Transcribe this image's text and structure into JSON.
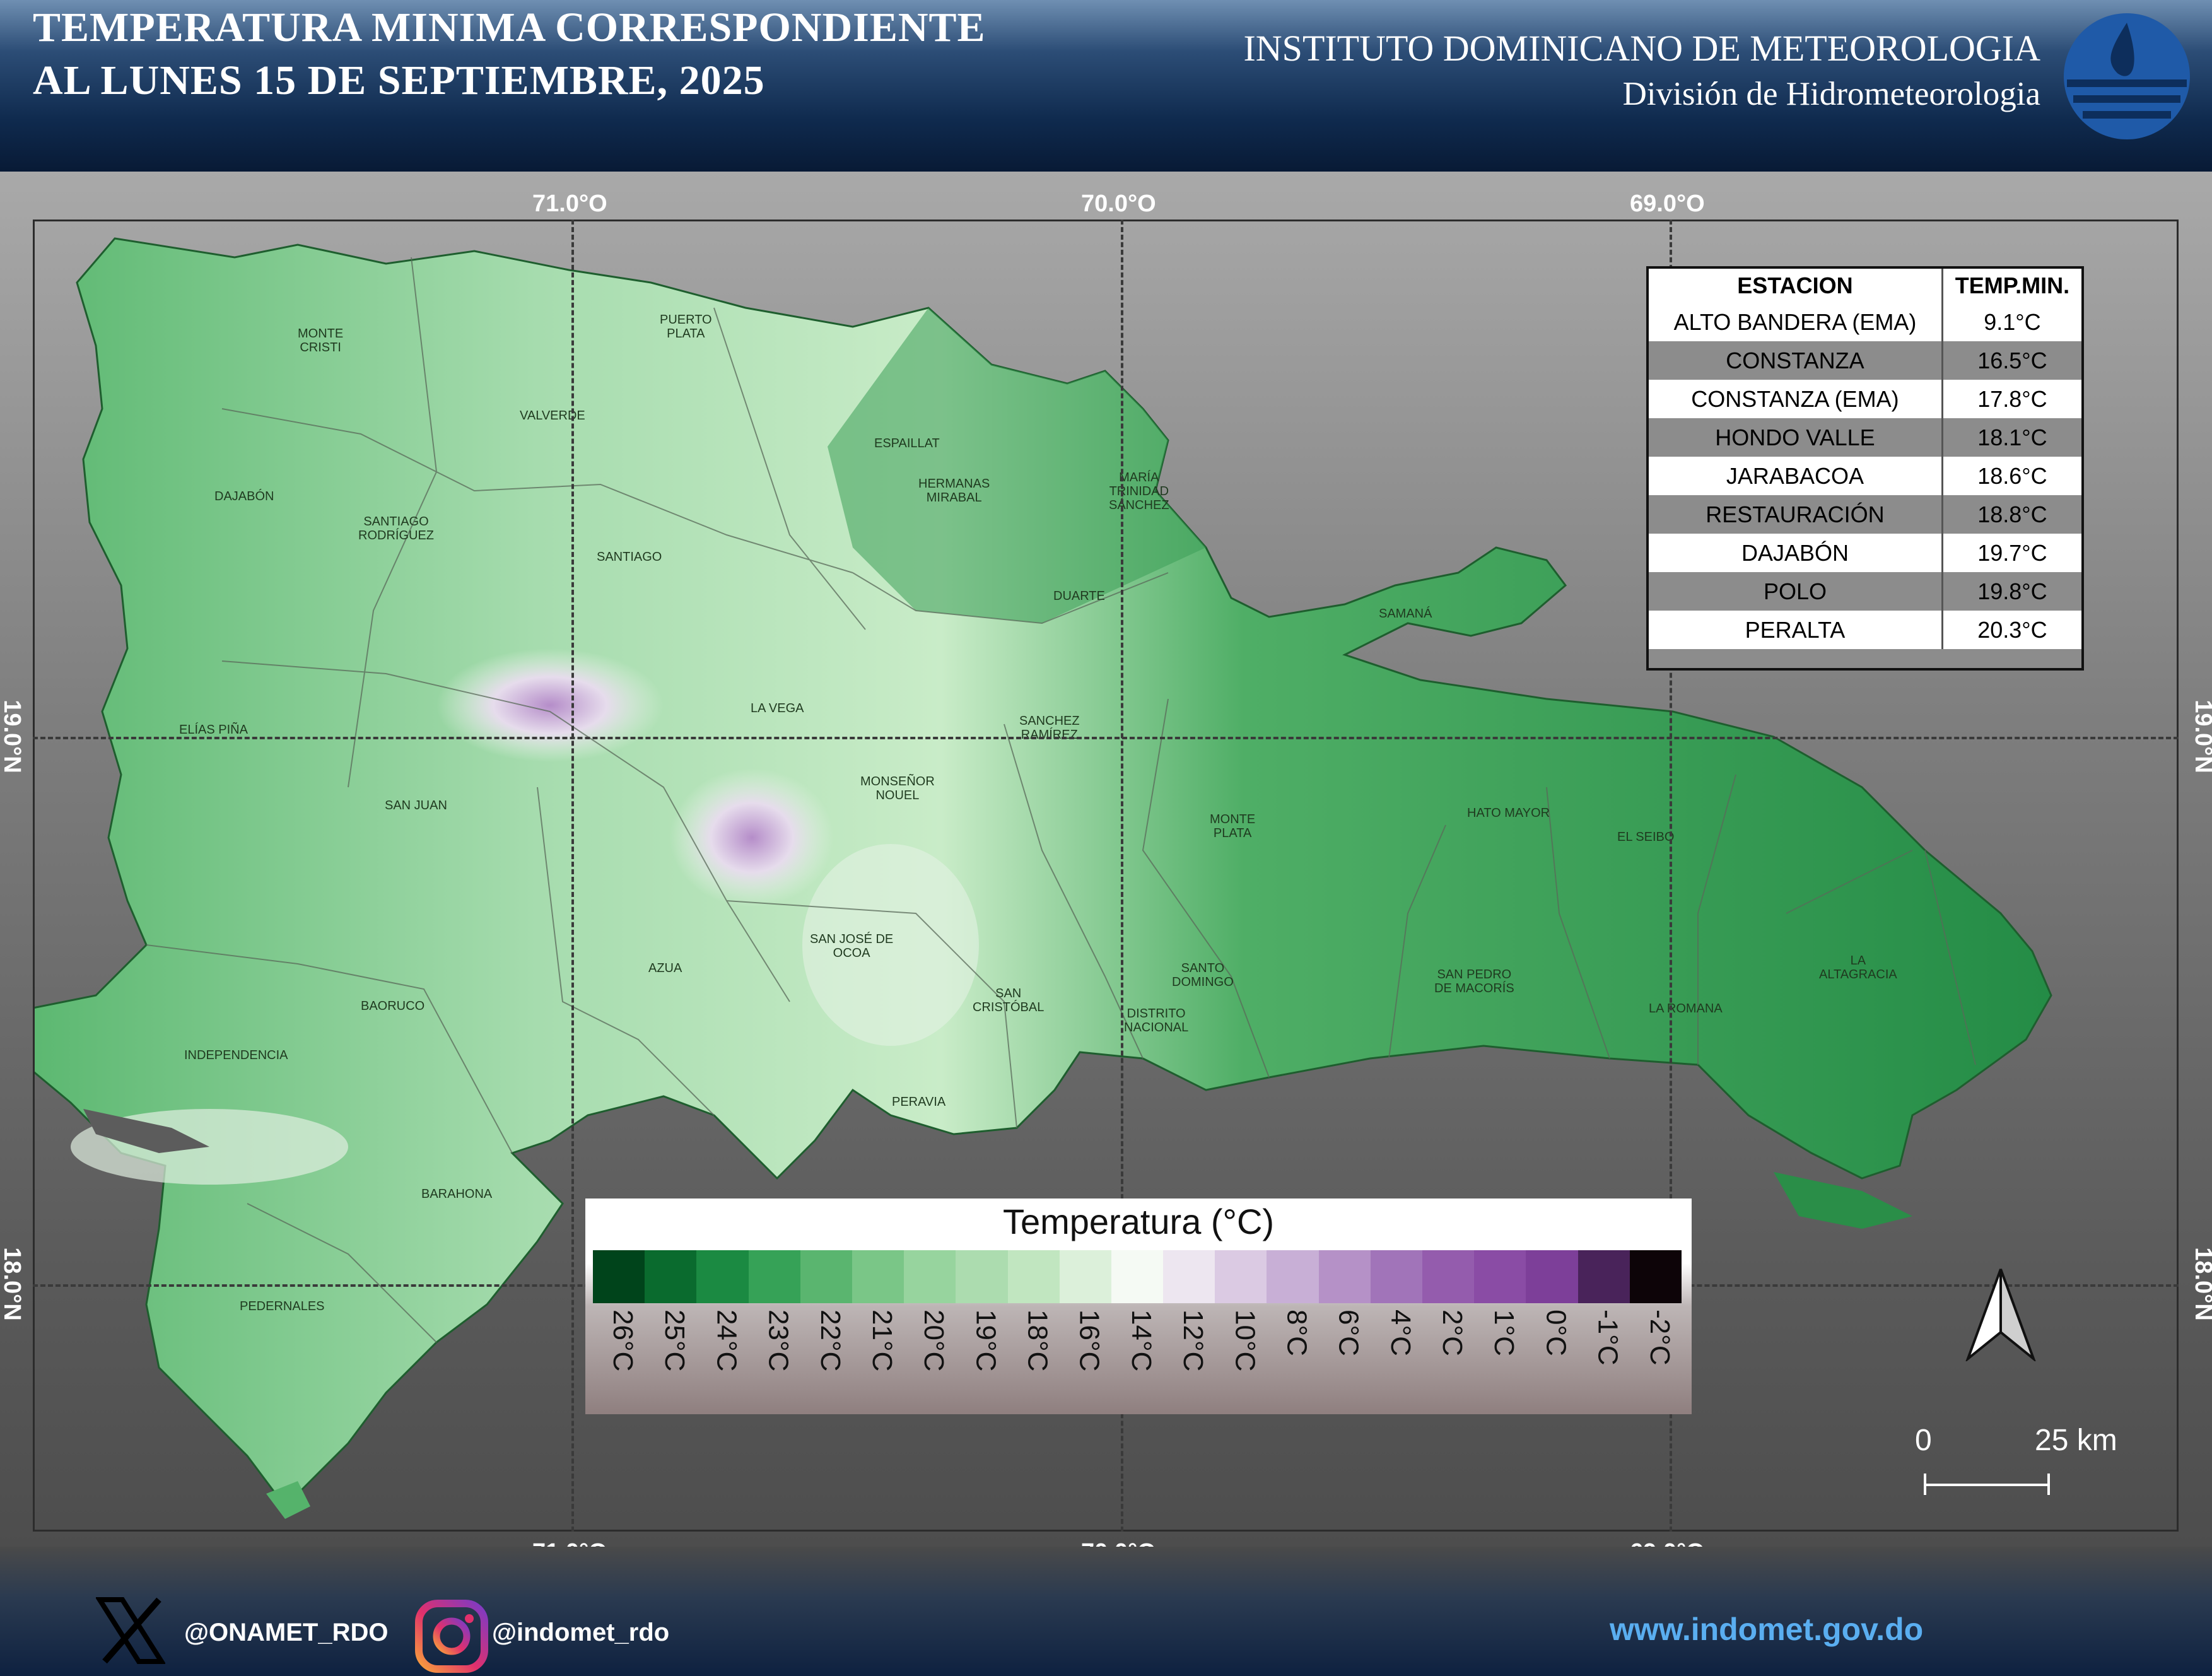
{
  "header": {
    "title_line1": "TEMPERATURA MINIMA CORRESPONDIENTE",
    "title_line2": "AL LUNES 15 DE SEPTIEMBRE, 2025",
    "institute": "INSTITUTO DOMINICANO DE METEOROLOGIA",
    "division": "División de Hidrometeorologia"
  },
  "map": {
    "lon_labels": [
      "71.0°O",
      "70.0°O",
      "69.0°O"
    ],
    "lat_labels": [
      "19.0°N",
      "18.0°N"
    ],
    "provinces": [
      "MONTE\nCRISTI",
      "PUERTO\nPLATA",
      "VALVERDE",
      "ESPAILLAT",
      "HERMANAS\nMIRABAL",
      "MARÍA\nTRINIDAD\nSÁNCHEZ",
      "DAJABÓN",
      "SANTIAGO\nRODRÍGUEZ",
      "SANTIAGO",
      "DUARTE",
      "SAMANÁ",
      "ELÍAS PIÑA",
      "LA VEGA",
      "SANCHEZ\nRAMÍREZ",
      "MONSEÑOR\nNOUEL",
      "SAN JUAN",
      "MONTE\nPLATA",
      "HATO MAYOR",
      "EL SEIBO",
      "SAN JOSÉ DE\nOCOA",
      "AZUA",
      "BAORUCO",
      "SAN\nCRISTÓBAL",
      "SANTO\nDOMINGO",
      "DISTRITO\nNACIONAL",
      "SAN PEDRO\nDE MACORÍS",
      "LA ROMANA",
      "LA\nALTAGRACIA",
      "INDEPENDENCIA",
      "PERAVIA",
      "BARAHONA",
      "PEDERNALES"
    ]
  },
  "table": {
    "headers": [
      "ESTACION",
      "TEMP.MIN."
    ],
    "rows": [
      {
        "station": "ALTO BANDERA (EMA)",
        "temp": "9.1°C"
      },
      {
        "station": "CONSTANZA",
        "temp": "16.5°C"
      },
      {
        "station": "CONSTANZA (EMA)",
        "temp": "17.8°C"
      },
      {
        "station": "HONDO VALLE",
        "temp": "18.1°C"
      },
      {
        "station": "JARABACOA",
        "temp": "18.6°C"
      },
      {
        "station": "RESTAURACIÓN",
        "temp": "18.8°C"
      },
      {
        "station": "DAJABÓN",
        "temp": "19.7°C"
      },
      {
        "station": "POLO",
        "temp": "19.8°C"
      },
      {
        "station": "PERALTA",
        "temp": "20.3°C"
      }
    ]
  },
  "legend": {
    "title": "Temperatura (°C)",
    "items": [
      {
        "label": "26°C",
        "color": "#00441b"
      },
      {
        "label": "25°C",
        "color": "#0a6b2e"
      },
      {
        "label": "24°C",
        "color": "#1b8a42"
      },
      {
        "label": "23°C",
        "color": "#36a257"
      },
      {
        "label": "22°C",
        "color": "#5ab56f"
      },
      {
        "label": "21°C",
        "color": "#7ac687"
      },
      {
        "label": "20°C",
        "color": "#97d49e"
      },
      {
        "label": "19°C",
        "color": "#acdcaf"
      },
      {
        "label": "18°C",
        "color": "#c1e6c0"
      },
      {
        "label": "16°C",
        "color": "#dcf0da"
      },
      {
        "label": "14°C",
        "color": "#f5faf4"
      },
      {
        "label": "12°C",
        "color": "#ede6f0"
      },
      {
        "label": "10°C",
        "color": "#dbcae3"
      },
      {
        "label": "8°C",
        "color": "#c8afd6"
      },
      {
        "label": "6°C",
        "color": "#b591c7"
      },
      {
        "label": "4°C",
        "color": "#a174b9"
      },
      {
        "label": "2°C",
        "color": "#945cad"
      },
      {
        "label": "1°C",
        "color": "#8a4ca5"
      },
      {
        "label": "0°C",
        "color": "#7d3f99"
      },
      {
        "label": "-1°C",
        "color": "#49235a"
      },
      {
        "label": "-2°C",
        "color": "#0d0408"
      }
    ]
  },
  "scale": {
    "start": "0",
    "end": "25 km"
  },
  "footer": {
    "x_handle": "@ONAMET_RDO",
    "ig_handle": "@indomet_rdo",
    "website": "www.indomet.gov.do"
  },
  "icons": [
    "x-logo-icon",
    "instagram-icon",
    "north-arrow-icon",
    "indomet-logo-icon"
  ]
}
